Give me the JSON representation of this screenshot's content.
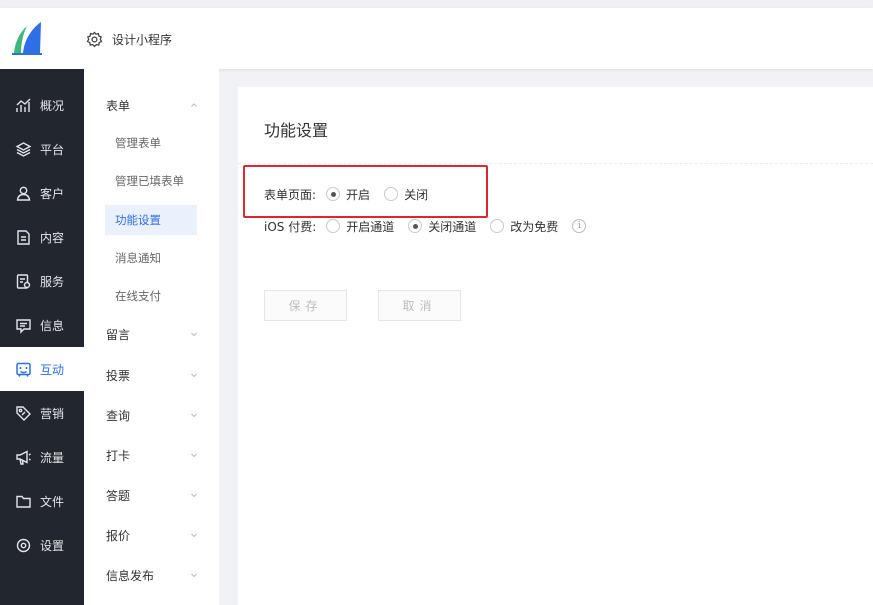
{
  "header": {
    "design_label": "设计小程序",
    "logo_icon": "sail-logo",
    "accent": "#2e6ee6"
  },
  "sidebar": {
    "items": [
      {
        "label": "概况",
        "icon": "chart-icon"
      },
      {
        "label": "平台",
        "icon": "layers-icon"
      },
      {
        "label": "客户",
        "icon": "user-icon"
      },
      {
        "label": "内容",
        "icon": "document-icon"
      },
      {
        "label": "服务",
        "icon": "service-icon"
      },
      {
        "label": "信息",
        "icon": "message-icon"
      },
      {
        "label": "互动",
        "icon": "interaction-icon",
        "active": true
      },
      {
        "label": "营销",
        "icon": "tag-icon"
      },
      {
        "label": "流量",
        "icon": "megaphone-icon"
      },
      {
        "label": "文件",
        "icon": "folder-icon"
      },
      {
        "label": "设置",
        "icon": "settings-icon"
      }
    ]
  },
  "subnav": {
    "form_group": "表单",
    "form_items": [
      "管理表单",
      "管理已填表单",
      "功能设置",
      "消息通知",
      "在线支付"
    ],
    "active_item": "功能设置",
    "groups": [
      "留言",
      "投票",
      "查询",
      "打卡",
      "答题",
      "报价",
      "信息发布"
    ]
  },
  "panel": {
    "title": "功能设置",
    "form_page": {
      "label": "表单页面:",
      "options": [
        "开启",
        "关闭"
      ],
      "selected": "开启"
    },
    "ios_pay": {
      "label": "iOS 付费:",
      "options": [
        "开启通道",
        "关闭通道",
        "改为免费"
      ],
      "selected": "关闭通道",
      "info_glyph": "i"
    },
    "save_label": "保存",
    "cancel_label": "取消"
  }
}
